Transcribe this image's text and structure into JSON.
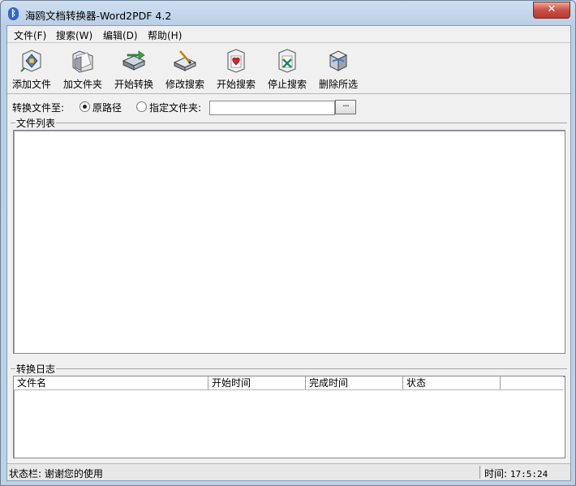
{
  "window": {
    "title": "海鸥文档转换器-Word2PDF 4.2",
    "close_glyph": "✕"
  },
  "menu": [
    {
      "label": "文件(F)"
    },
    {
      "label": "搜索(W)"
    },
    {
      "label": "编辑(D)"
    },
    {
      "label": "帮助(H)"
    }
  ],
  "toolbar": [
    {
      "label": "添加文件",
      "icon": "add-file-icon"
    },
    {
      "label": "加文件夹",
      "icon": "add-folder-icon"
    },
    {
      "label": "开始转换",
      "icon": "start-convert-icon"
    },
    {
      "label": "修改搜索",
      "icon": "edit-search-icon"
    },
    {
      "label": "开始搜索",
      "icon": "start-search-icon"
    },
    {
      "label": "停止搜索",
      "icon": "stop-search-icon"
    },
    {
      "label": "删除所选",
      "icon": "delete-selected-icon"
    }
  ],
  "convert": {
    "label": "转换文件至:",
    "option_original": "原路径",
    "option_folder": "指定文件夹:",
    "selected": "原路径",
    "folder_value": "",
    "browse_label": "···"
  },
  "file_list": {
    "title": "文件列表"
  },
  "log": {
    "title": "转换日志",
    "columns": [
      "文件名",
      "开始时间",
      "完成时间",
      "状态",
      ""
    ]
  },
  "status": {
    "text": "状态栏: 谢谢您的使用",
    "time_label": "时间:",
    "time_value": "17:5:24"
  }
}
